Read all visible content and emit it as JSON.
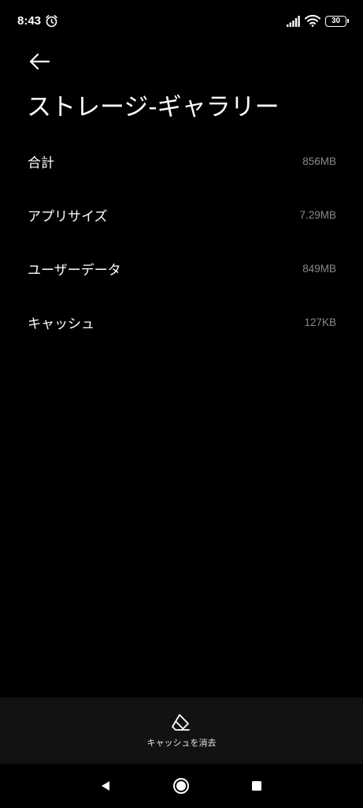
{
  "status_bar": {
    "time": "8:43",
    "battery": "30",
    "icons": [
      "alarm-icon",
      "signal-icon",
      "wifi-icon",
      "battery-icon"
    ]
  },
  "header": {
    "back_icon": "arrow-left-icon",
    "title": "ストレージ-ギャラリー"
  },
  "storage": {
    "items": [
      {
        "label": "合計",
        "value": "856MB"
      },
      {
        "label": "アプリサイズ",
        "value": "7.29MB"
      },
      {
        "label": "ユーザーデータ",
        "value": "849MB"
      },
      {
        "label": "キャッシュ",
        "value": "127KB"
      }
    ]
  },
  "bottom_action": {
    "icon": "eraser-icon",
    "label": "キャッシュを消去"
  },
  "nav": {
    "icons": [
      "nav-back-icon",
      "nav-home-icon",
      "nav-recents-icon"
    ]
  },
  "colors": {
    "background": "#000000",
    "bottom_bar": "#121212",
    "value_text": "#8a8a8a"
  }
}
